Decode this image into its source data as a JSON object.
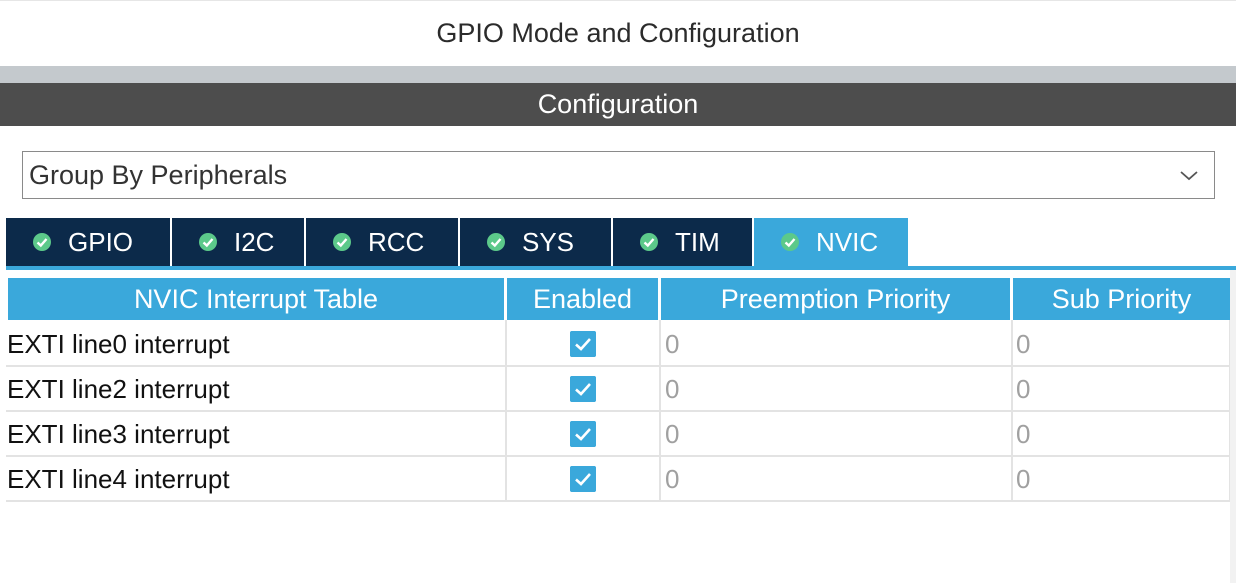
{
  "header": {
    "title": "GPIO Mode and Configuration",
    "configuration_label": "Configuration"
  },
  "group_select": {
    "value": "Group By Peripherals"
  },
  "tabs": [
    {
      "label": "GPIO",
      "active": false
    },
    {
      "label": "I2C",
      "active": false
    },
    {
      "label": "RCC",
      "active": false
    },
    {
      "label": "SYS",
      "active": false
    },
    {
      "label": "TIM",
      "active": false
    },
    {
      "label": "NVIC",
      "active": true
    }
  ],
  "table": {
    "columns": [
      "NVIC Interrupt Table",
      "Enabled",
      "Preemption Priority",
      "Sub Priority"
    ],
    "rows": [
      {
        "name": "EXTI line0 interrupt",
        "enabled": true,
        "preemption": "0",
        "sub": "0"
      },
      {
        "name": "EXTI line2 interrupt",
        "enabled": true,
        "preemption": "0",
        "sub": "0"
      },
      {
        "name": "EXTI line3 interrupt",
        "enabled": true,
        "preemption": "0",
        "sub": "0"
      },
      {
        "name": "EXTI line4 interrupt",
        "enabled": true,
        "preemption": "0",
        "sub": "0"
      }
    ]
  },
  "colors": {
    "accent": "#3aa8db",
    "tab_dark": "#0c2a4a",
    "config_bar": "#4d4d4d"
  }
}
